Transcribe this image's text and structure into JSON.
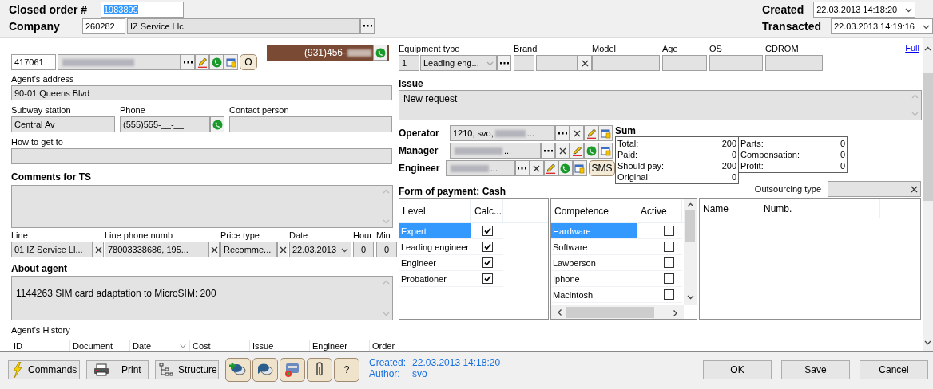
{
  "header": {
    "order_label": "Closed order #",
    "order_number": "1983899",
    "order_selected": true,
    "company_label": "Company",
    "company_code": "260282",
    "company_name": "IZ Service Llc",
    "created_label": "Created",
    "created": "22.03.2013 14:18:20",
    "transacted_label": "Transacted",
    "transacted": "22.03.2013 14:19:16"
  },
  "agent": {
    "caller_phone": "(931)456-",
    "code": "417061",
    "round_button": "O",
    "address_label": "Agent's address",
    "address": "90-01 Queens Blvd",
    "subway_label": "Subway station",
    "subway": "Central Av",
    "phone_label": "Phone",
    "phone": "(555)555-__-__",
    "contact_label": "Contact person",
    "directions_label": "How to get to"
  },
  "comments": {
    "title": "Comments for TS"
  },
  "line_fields": [
    {
      "label": "Line",
      "value": "01 IZ Service Ll...",
      "kind": "clearable"
    },
    {
      "label": "Line phone numb",
      "value": "78003338686, 195...",
      "kind": "clearable"
    },
    {
      "label": "Price type",
      "value": "Recomme...",
      "kind": "clearable"
    },
    {
      "label": "Date",
      "value": "22.03.2013",
      "kind": "dropdown"
    },
    {
      "label": "Hour",
      "value": "0",
      "kind": "number"
    },
    {
      "label": "Min",
      "value": "0",
      "kind": "number"
    }
  ],
  "about": {
    "title": "About agent",
    "text": "1144263 SIM card adaptation to MicroSIM: 200"
  },
  "history": {
    "title": "Agent's History",
    "columns": [
      {
        "label": "ID",
        "sorted": false
      },
      {
        "label": "Document",
        "sorted": false
      },
      {
        "label": "Date",
        "sorted": true
      },
      {
        "label": "Cost",
        "sorted": false
      },
      {
        "label": "Issue",
        "sorted": false
      },
      {
        "label": "Engineer",
        "sorted": false
      },
      {
        "label": "Order",
        "sorted": false
      }
    ]
  },
  "equipment": {
    "labels": [
      "Equipment type",
      "Brand",
      "Model",
      "Age",
      "OS",
      "CDROM"
    ],
    "type_code": "1",
    "type": "Leading eng...",
    "full_link": "Full"
  },
  "issue": {
    "title": "Issue",
    "text": "New request"
  },
  "staff": [
    {
      "label": "Operator",
      "prefix": "1210, svo,",
      "suffix": "...",
      "buttons": [
        {
          "kind": "more"
        },
        {
          "kind": "clear"
        },
        {
          "kind": "edit"
        },
        {
          "kind": "card"
        }
      ]
    },
    {
      "label": "Manager",
      "suffix": " ...",
      "buttons": [
        {
          "kind": "more"
        },
        {
          "kind": "clear"
        },
        {
          "kind": "edit"
        },
        {
          "kind": "call"
        },
        {
          "kind": "card"
        }
      ]
    },
    {
      "label": "Engineer",
      "suffix": "...",
      "buttons": [
        {
          "kind": "more"
        },
        {
          "kind": "clear"
        },
        {
          "kind": "edit"
        },
        {
          "kind": "call"
        },
        {
          "kind": "card"
        }
      ],
      "sms": "SMS"
    }
  ],
  "sum": {
    "title": "Sum",
    "left": [
      {
        "label": "Total:",
        "value": "200"
      },
      {
        "label": "Paid:",
        "value": "0"
      },
      {
        "label": "Should pay:",
        "value": "200"
      },
      {
        "label": "Original:",
        "value": "0"
      }
    ],
    "right": [
      {
        "label": "Parts:",
        "value": "0"
      },
      {
        "label": "Compensation:",
        "value": "0"
      },
      {
        "label": "Profit:",
        "value": "0"
      }
    ]
  },
  "payment": "Form of payment:  Cash",
  "outsourcing_label": "Outsourcing type",
  "levels": {
    "columns": [
      "Level",
      "Calc..."
    ],
    "rows": [
      {
        "name": "Expert",
        "checked": true,
        "selected": true
      },
      {
        "name": "Leading engineer",
        "checked": true,
        "selected": false
      },
      {
        "name": "Engineer",
        "checked": true,
        "selected": false
      },
      {
        "name": "Probationer",
        "checked": true,
        "selected": false
      }
    ]
  },
  "competences": {
    "columns": [
      "Competence",
      "Active"
    ],
    "rows": [
      {
        "name": "Hardware",
        "checked": false,
        "selected": true
      },
      {
        "name": "Software",
        "checked": false,
        "selected": false
      },
      {
        "name": "Lawperson",
        "checked": false,
        "selected": false
      },
      {
        "name": "Iphone",
        "checked": false,
        "selected": false
      },
      {
        "name": "Macintosh",
        "checked": false,
        "selected": false
      }
    ]
  },
  "outsourcing": {
    "columns": [
      "Name",
      "Numb."
    ]
  },
  "footer": {
    "buttons": [
      {
        "kind": "commands",
        "label": "Commands"
      },
      {
        "kind": "print",
        "label": "Print"
      },
      {
        "kind": "structure",
        "label": "Structure"
      }
    ],
    "icon_buttons": [
      {
        "kind": "add-comment"
      },
      {
        "kind": "comment"
      },
      {
        "kind": "palette"
      },
      {
        "kind": "attach"
      },
      {
        "kind": "help",
        "label": "?"
      }
    ],
    "created_label": "Created:",
    "created": "22.03.2013 14:18:20",
    "author_label": "Author:",
    "author": "svo",
    "actions": [
      "OK",
      "Save",
      "Cancel"
    ]
  }
}
